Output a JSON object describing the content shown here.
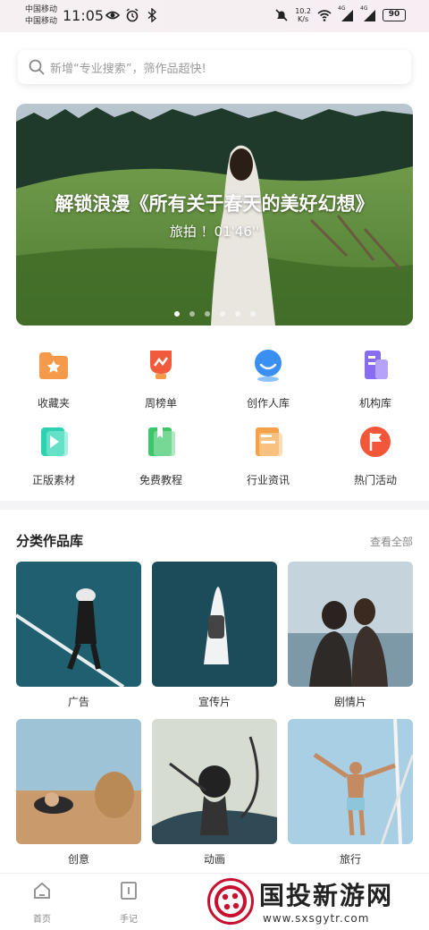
{
  "status_bar": {
    "carrier_1": "中国移动",
    "carrier_2": "中国移动",
    "time": "11:05",
    "net_speed_value": "10.2",
    "net_speed_unit": "K/s",
    "signal_1_label": "4G",
    "signal_2_label": "4G",
    "battery": "90"
  },
  "search": {
    "placeholder": "新增“专业搜索”，筛作品超快!"
  },
  "banner": {
    "title": "解锁浪漫《所有关于春天的美好幻想》",
    "subtitle": "旅拍 ！01'46''",
    "dot_count": 6,
    "active_dot": 0
  },
  "shortcuts": [
    {
      "label": "收藏夹",
      "icon": "folder-star-icon",
      "color": "#f59a4b"
    },
    {
      "label": "周榜单",
      "icon": "trophy-icon",
      "color": "#f25a3c"
    },
    {
      "label": "创作人库",
      "icon": "creator-icon",
      "color": "#3a8ff2"
    },
    {
      "label": "机构库",
      "icon": "building-icon",
      "color": "#8a6cf0"
    },
    {
      "label": "正版素材",
      "icon": "video-play-icon",
      "color": "#2ed1b0"
    },
    {
      "label": "免费教程",
      "icon": "bookmark-book-icon",
      "color": "#3cc56a"
    },
    {
      "label": "行业资讯",
      "icon": "news-icon",
      "color": "#f5a14a"
    },
    {
      "label": "热门活动",
      "icon": "flag-icon",
      "color": "#f2573a"
    }
  ],
  "section": {
    "title": "分类作品库",
    "more": "查看全部"
  },
  "categories": [
    {
      "label": "广告"
    },
    {
      "label": "宣传片"
    },
    {
      "label": "剧情片"
    },
    {
      "label": "创意"
    },
    {
      "label": "动画"
    },
    {
      "label": "旅行"
    }
  ],
  "tabbar": [
    {
      "label": "首页",
      "icon": "home-icon"
    },
    {
      "label": "手记",
      "icon": "notebook-icon"
    }
  ],
  "watermark": {
    "title": "国投新游网",
    "url": "www.sxsgytr.com"
  }
}
